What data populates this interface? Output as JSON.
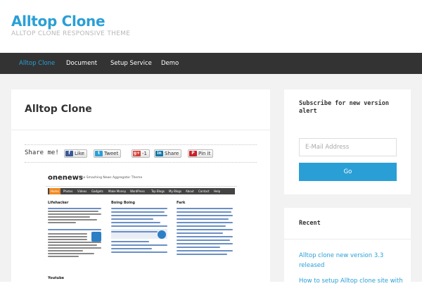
{
  "header": {
    "site_title": "Alltop Clone",
    "tagline": "ALLTOP CLONE RESPONSIVE THEME"
  },
  "nav": {
    "items": [
      {
        "label": "Alltop Clone",
        "active": true
      },
      {
        "label": "Document",
        "active": false
      },
      {
        "label": "Setup Service",
        "active": false
      },
      {
        "label": "Demo",
        "active": false
      }
    ]
  },
  "main": {
    "title": "Alltop Clone",
    "share_label": "Share me!",
    "share_buttons": [
      {
        "label": "Like",
        "icon": "f"
      },
      {
        "label": "Tweet",
        "icon": "t"
      },
      {
        "label": "-1",
        "icon": "g+"
      },
      {
        "label": "Share",
        "icon": "in"
      },
      {
        "label": "Pin it",
        "icon": "P"
      }
    ],
    "screenshot": {
      "logo": "onenews",
      "tagline": "The Smashing News Aggregator Theme",
      "nav": [
        "Home",
        "Photos",
        "Videos",
        "Gadgets",
        "Make Money",
        "WordPress",
        "Top Blogs",
        "My Blogs",
        "About",
        "Contact",
        "Help"
      ],
      "columns": [
        "Lifehacker",
        "Boing Boing",
        "Fark"
      ],
      "bottom_col": "Youtube"
    }
  },
  "sidebar": {
    "subscribe_title": "Subscribe for new version alert",
    "email_placeholder": "E-Mail Address",
    "go_label": "Go",
    "recent_title": "Recent",
    "recent_items": [
      "Alltop clone new version 3.3 released",
      "How to setup Alltop clone site with"
    ]
  },
  "colors": {
    "accent": "#2a9fd6",
    "nav_bg": "#333333",
    "page_bg": "#f2f2f2"
  }
}
